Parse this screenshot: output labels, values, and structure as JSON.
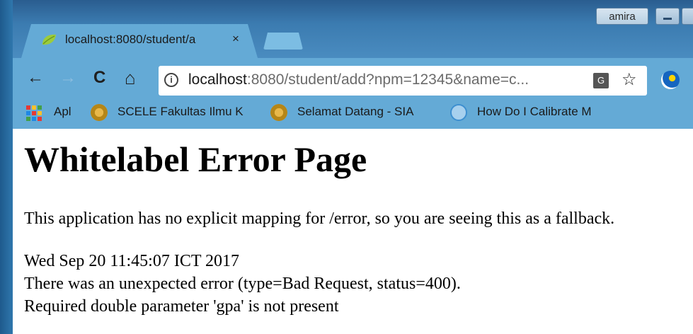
{
  "window": {
    "user_label": "amira"
  },
  "tab": {
    "title": "localhost:8080/student/a",
    "close_glyph": "×",
    "favicon": "spring-leaf-icon"
  },
  "toolbar": {
    "back_glyph": "←",
    "forward_glyph": "→",
    "reload_glyph": "C",
    "home_glyph": "⌂",
    "url_host": "localhost",
    "url_rest": ":8080/student/add?npm=12345&name=c...",
    "info_glyph": "i",
    "translate_glyph": "G",
    "star_glyph": "☆"
  },
  "bookmarks": {
    "items": [
      {
        "label": "Apl",
        "icon": "apps-grid-icon"
      },
      {
        "label": "SCELE Fakultas Ilmu K",
        "icon": "seal-icon"
      },
      {
        "label": "Selamat Datang - SIA",
        "icon": "seal-icon"
      },
      {
        "label": "How Do I Calibrate M",
        "icon": "globe-icon"
      }
    ]
  },
  "page": {
    "title": "Whitelabel Error Page",
    "message": "This application has no explicit mapping for /error, so you are seeing this as a fallback.",
    "timestamp": "Wed Sep 20 11:45:07 ICT 2017",
    "error": "There was an unexpected error (type=Bad Request, status=400).",
    "detail": "Required double parameter 'gpa' is not present"
  },
  "colors": {
    "chrome": "#64aad6",
    "frame": "#2f77ad",
    "text": "#000000"
  }
}
